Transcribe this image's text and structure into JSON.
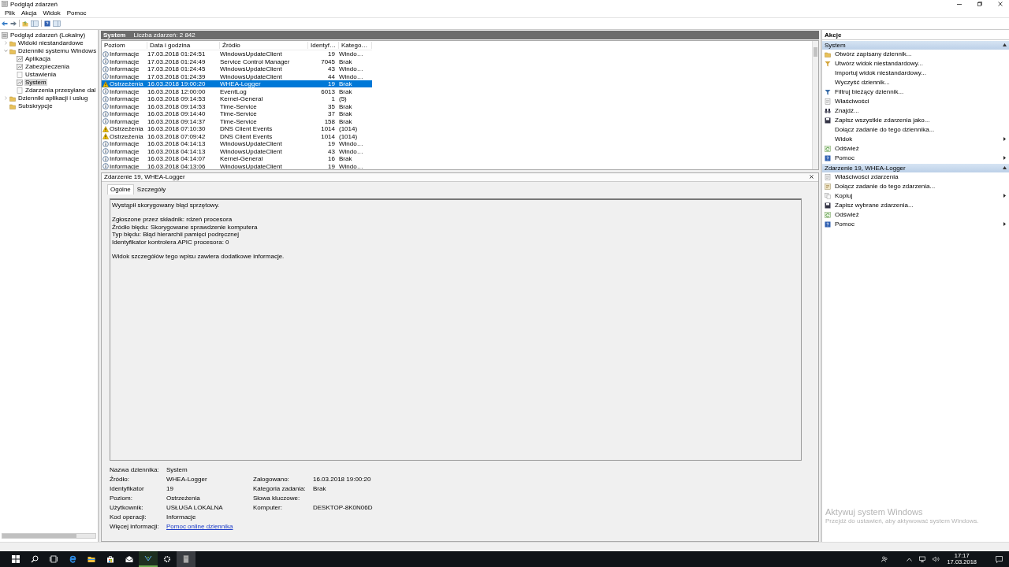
{
  "window": {
    "title": "Podgląd zdarzeń"
  },
  "menu": [
    "Plik",
    "Akcja",
    "Widok",
    "Pomoc"
  ],
  "tree": [
    {
      "label": "Podgląd zdarzeń (Lokalny)",
      "kind": "root",
      "selected": false,
      "children": [
        {
          "label": "Widoki niestandardowe",
          "kind": "folder",
          "selected": false,
          "expanded": false
        },
        {
          "label": "Dzienniki systemu Windows",
          "kind": "folder",
          "selected": false,
          "expanded": true,
          "children": [
            {
              "label": "Aplikacja",
              "kind": "log",
              "selected": false
            },
            {
              "label": "Zabezpieczenia",
              "kind": "log",
              "selected": false
            },
            {
              "label": "Ustawienia",
              "kind": "page",
              "selected": false
            },
            {
              "label": "System",
              "kind": "log",
              "selected": true
            },
            {
              "label": "Zdarzenia przesyłane dal",
              "kind": "page",
              "selected": false
            }
          ]
        },
        {
          "label": "Dzienniki aplikacji i usług",
          "kind": "folder",
          "selected": false,
          "expanded": false
        },
        {
          "label": "Subskrypcje",
          "kind": "folder",
          "selected": false
        }
      ]
    }
  ],
  "log_header": {
    "title": "System",
    "count": "Liczba zdarzeń: 2 842"
  },
  "events": {
    "columns": [
      "Poziom",
      "Data i godzina",
      "Źródło",
      "Identyf…",
      "Katego…"
    ],
    "rows": [
      {
        "kind": "info",
        "severity": "Informacje",
        "date": "17.03.2018 01:24:51",
        "source": "WindowsUpdateClient",
        "id": "19",
        "category": "Windo…",
        "selected": false
      },
      {
        "kind": "info",
        "severity": "Informacje",
        "date": "17.03.2018 01:24:49",
        "source": "Service Control Manager",
        "id": "7045",
        "category": "Brak",
        "selected": false
      },
      {
        "kind": "info",
        "severity": "Informacje",
        "date": "17.03.2018 01:24:45",
        "source": "WindowsUpdateClient",
        "id": "43",
        "category": "Windo…",
        "selected": false
      },
      {
        "kind": "info",
        "severity": "Informacje",
        "date": "17.03.2018 01:24:39",
        "source": "WindowsUpdateClient",
        "id": "44",
        "category": "Windo…",
        "selected": false
      },
      {
        "kind": "warning",
        "severity": "Ostrzeżenia",
        "date": "16.03.2018 19:00:20",
        "source": "WHEA-Logger",
        "id": "19",
        "category": "Brak",
        "selected": true
      },
      {
        "kind": "info",
        "severity": "Informacje",
        "date": "16.03.2018 12:00:00",
        "source": "EventLog",
        "id": "6013",
        "category": "Brak",
        "selected": false
      },
      {
        "kind": "info",
        "severity": "Informacje",
        "date": "16.03.2018 09:14:53",
        "source": "Kernel-General",
        "id": "1",
        "category": "(5)",
        "selected": false
      },
      {
        "kind": "info",
        "severity": "Informacje",
        "date": "16.03.2018 09:14:53",
        "source": "Time-Service",
        "id": "35",
        "category": "Brak",
        "selected": false
      },
      {
        "kind": "info",
        "severity": "Informacje",
        "date": "16.03.2018 09:14:40",
        "source": "Time-Service",
        "id": "37",
        "category": "Brak",
        "selected": false
      },
      {
        "kind": "info",
        "severity": "Informacje",
        "date": "16.03.2018 09:14:37",
        "source": "Time-Service",
        "id": "158",
        "category": "Brak",
        "selected": false
      },
      {
        "kind": "warning",
        "severity": "Ostrzeżenia",
        "date": "16.03.2018 07:10:30",
        "source": "DNS Client Events",
        "id": "1014",
        "category": "(1014)",
        "selected": false
      },
      {
        "kind": "warning",
        "severity": "Ostrzeżenia",
        "date": "16.03.2018 07:09:42",
        "source": "DNS Client Events",
        "id": "1014",
        "category": "(1014)",
        "selected": false
      },
      {
        "kind": "info",
        "severity": "Informacje",
        "date": "16.03.2018 04:14:13",
        "source": "WindowsUpdateClient",
        "id": "19",
        "category": "Windo…",
        "selected": false
      },
      {
        "kind": "info",
        "severity": "Informacje",
        "date": "16.03.2018 04:14:13",
        "source": "WindowsUpdateClient",
        "id": "43",
        "category": "Windo…",
        "selected": false
      },
      {
        "kind": "info",
        "severity": "Informacje",
        "date": "16.03.2018 04:14:07",
        "source": "Kernel-General",
        "id": "16",
        "category": "Brak",
        "selected": false
      },
      {
        "kind": "info",
        "severity": "Informacje",
        "date": "16.03.2018 04:13:06",
        "source": "WindowsUpdateClient",
        "id": "19",
        "category": "Windo…",
        "selected": false
      }
    ]
  },
  "details": {
    "title": "Zdarzenie 19, WHEA-Logger",
    "tabs": [
      {
        "label": "Ogólne",
        "selected": true
      },
      {
        "label": "Szczegóły",
        "selected": false
      }
    ],
    "description": [
      [
        "Wystąpił skorygowany błąd sprzętowy."
      ],
      [
        "Zgłoszone przez składnik: rdzeń procesora",
        "Źródło błędu: Skorygowane sprawdzenie komputera",
        "Typ błędu: Błąd hierarchii pamięci podręcznej",
        "Identyfikator kontrolera APIC procesora: 0"
      ],
      [
        "Widok szczegółów tego wpisu zawiera dodatkowe informacje."
      ]
    ],
    "properties": [
      {
        "label": "Nazwa dziennika:",
        "value": "System"
      },
      {
        "label": "Źródło:",
        "value": "WHEA-Logger",
        "label2": "Zalogowano:",
        "value2": "16.03.2018 19:00:20"
      },
      {
        "label": "Identyfikator",
        "value": "19",
        "label2": "Kategoria zadania:",
        "value2": "Brak"
      },
      {
        "label": "Poziom:",
        "value": "Ostrzeżenia",
        "label2": "Słowa kluczowe:"
      },
      {
        "label": "Użytkownik:",
        "value": "USŁUGA LOKALNA",
        "label2": "Komputer:",
        "value2": "DESKTOP-8K0N06D"
      },
      {
        "label": "Kod operacji:",
        "value": "Informacje"
      },
      {
        "label": "Więcej informacji:",
        "link": "Pomoc online dziennika"
      }
    ]
  },
  "actions": {
    "title": "Akcje",
    "sections": [
      {
        "title": "System",
        "items": [
          {
            "label": "Otwórz zapisany dziennik...",
            "kind": "folder",
            "submenu": false
          },
          {
            "label": "Utwórz widok niestandardowy...",
            "kind": "funnel",
            "submenu": false
          },
          {
            "label": "Importuj widok niestandardowy...",
            "kind": "plain",
            "submenu": false
          },
          {
            "label": "Wyczyść dziennik...",
            "kind": "plain",
            "submenu": false
          },
          {
            "label": "Filtruj bieżący dziennik...",
            "kind": "filter",
            "submenu": false
          },
          {
            "label": "Właściwości",
            "kind": "properties",
            "submenu": false
          },
          {
            "label": "Znajdź...",
            "kind": "find",
            "submenu": false
          },
          {
            "label": "Zapisz wszystkie zdarzenia jako...",
            "kind": "save",
            "submenu": false
          },
          {
            "label": "Dołącz zadanie do tego dziennika...",
            "kind": "plain",
            "submenu": false
          },
          {
            "label": "Widok",
            "kind": "plain",
            "submenu": true
          },
          {
            "label": "Odśwież",
            "kind": "refresh",
            "submenu": false
          },
          {
            "label": "Pomoc",
            "kind": "help",
            "submenu": true
          }
        ]
      },
      {
        "title": "Zdarzenie 19, WHEA-Logger",
        "items": [
          {
            "label": "Właściwości zdarzenia",
            "kind": "properties",
            "submenu": false
          },
          {
            "label": "Dołącz zadanie do tego zdarzenia...",
            "kind": "task",
            "submenu": false
          },
          {
            "label": "Kopiuj",
            "kind": "copy",
            "submenu": true
          },
          {
            "label": "Zapisz wybrane zdarzenia...",
            "kind": "save",
            "submenu": false
          },
          {
            "label": "Odśwież",
            "kind": "refresh",
            "submenu": false
          },
          {
            "label": "Pomoc",
            "kind": "help",
            "submenu": true
          }
        ]
      }
    ]
  },
  "activation_notice": {
    "title": "Aktywuj system Windows",
    "text": "Przejdź do ustawień, aby aktywować system Windows."
  },
  "taskbar": {
    "time": "17:17",
    "date": "17.03.2018"
  }
}
